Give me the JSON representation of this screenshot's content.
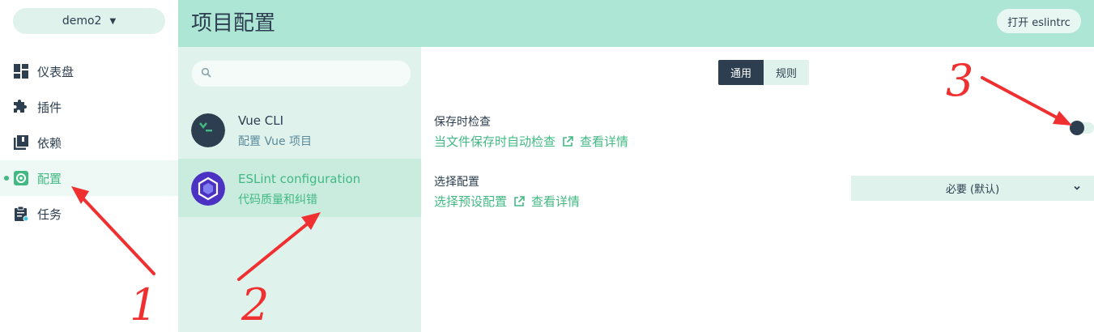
{
  "nav": {
    "project": "demo2",
    "items": [
      {
        "label": "仪表盘",
        "icon": "dashboard-icon"
      },
      {
        "label": "插件",
        "icon": "puzzle-icon"
      },
      {
        "label": "依赖",
        "icon": "library-icon"
      },
      {
        "label": "配置",
        "icon": "gear-icon",
        "active": true
      },
      {
        "label": "任务",
        "icon": "clipboard-icon"
      }
    ]
  },
  "header": {
    "title": "项目配置",
    "open_button": "打开 eslintrc"
  },
  "config_list": {
    "search_placeholder": "",
    "items": [
      {
        "name": "Vue CLI",
        "desc": "配置 Vue 项目"
      },
      {
        "name": "ESLint configuration",
        "desc": "代码质量和纠错",
        "active": true
      }
    ]
  },
  "content": {
    "tabs": [
      "通用",
      "规则"
    ],
    "active_tab": "通用",
    "settings": [
      {
        "title": "保存时检查",
        "desc": "当文件保存时自动检查",
        "more": "查看详情",
        "control": "toggle",
        "value": true
      },
      {
        "title": "选择配置",
        "desc": "选择预设配置",
        "more": "查看详情",
        "control": "select",
        "value": "必要 (默认)"
      }
    ]
  },
  "annotations": [
    "1",
    "2",
    "3"
  ],
  "colors": {
    "accent": "#42b983",
    "dark": "#2c3e50",
    "header": "#aee6d6",
    "panel": "#dff3ec",
    "arrow": "#f03030"
  }
}
